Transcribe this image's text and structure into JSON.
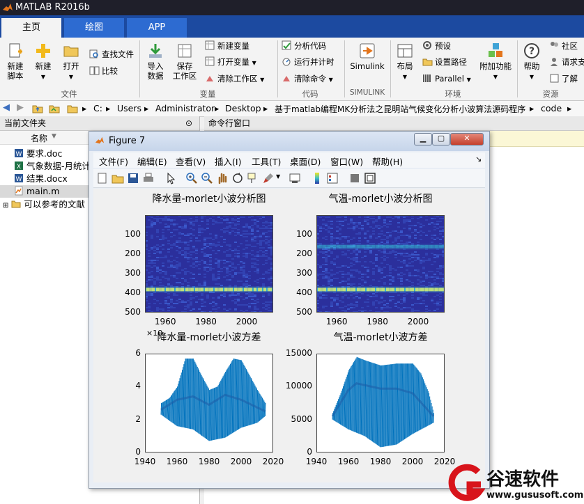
{
  "app": {
    "title": "MATLAB R2016b"
  },
  "tabs": [
    {
      "label": "主页"
    },
    {
      "label": "绘图"
    },
    {
      "label": "APP"
    }
  ],
  "ribbon": {
    "file": {
      "new_script": "新建\n脚本",
      "new": "新建",
      "open": "打开",
      "find_files": "查找文件",
      "compare": "比较",
      "group": "文件"
    },
    "variable": {
      "import": "导入\n数据",
      "save_ws": "保存\n工作区",
      "new_var": "新建变量",
      "open_var": "打开变量",
      "clear_ws": "清除工作区",
      "group": "变量"
    },
    "code": {
      "analyze": "分析代码",
      "run_time": "运行并计时",
      "clear_cmd": "清除命令",
      "group": "代码"
    },
    "simulink": {
      "simulink": "Simulink",
      "group": "SIMULINK"
    },
    "env": {
      "layout": "布局",
      "prefs": "预设",
      "set_path": "设置路径",
      "parallel": "Parallel",
      "addons": "附加功能",
      "group": "环境"
    },
    "resources": {
      "help": "帮助",
      "community": "社区",
      "request": "请求支",
      "learn": "了解",
      "group": "资源"
    }
  },
  "address": {
    "crumbs": [
      "C:",
      "Users",
      "Administrator",
      "Desktop",
      "基于matlab编程MK分析法之昆明站气候变化分析小波算法源码程序",
      "code"
    ]
  },
  "left_panel": {
    "title": "当前文件夹",
    "col_name": "名称",
    "files": [
      {
        "name": "要求.doc"
      },
      {
        "name": "气象数据-月统计"
      },
      {
        "name": "结果.docx"
      },
      {
        "name": "main.m"
      },
      {
        "name": "可以参考的文献"
      }
    ]
  },
  "right_panel": {
    "title": "命令行窗口"
  },
  "figure": {
    "title": "Figure 7",
    "menu": [
      "文件(F)",
      "编辑(E)",
      "查看(V)",
      "插入(I)",
      "工具(T)",
      "桌面(D)",
      "窗口(W)",
      "帮助(H)"
    ],
    "colors": {
      "heat_bg": "#2b2f9c",
      "heat_band": "#37c7d8",
      "series": "#0072bd"
    }
  },
  "chart_data": [
    {
      "type": "heatmap",
      "title": "降水量-morlet小波分析图",
      "x_ticks": [
        "1960",
        "1980",
        "2000"
      ],
      "y_ticks": [
        "100",
        "200",
        "300",
        "400",
        "500"
      ],
      "xlim": [
        1950,
        2013
      ],
      "ylim": [
        0,
        500
      ],
      "y_reversed": true,
      "bands": [
        {
          "y": 380,
          "strength": 0.9
        }
      ]
    },
    {
      "type": "heatmap",
      "title": "气温-morlet小波分析图",
      "x_ticks": [
        "1960",
        "1980",
        "2000"
      ],
      "y_ticks": [
        "100",
        "200",
        "300",
        "400",
        "500"
      ],
      "xlim": [
        1950,
        2013
      ],
      "ylim": [
        0,
        500
      ],
      "y_reversed": true,
      "bands": [
        {
          "y": 160,
          "strength": 0.35
        },
        {
          "y": 380,
          "strength": 0.95
        }
      ]
    },
    {
      "type": "line",
      "title": "降水量-morlet小波方差",
      "exponent_label": "×10",
      "x_ticks": [
        "1940",
        "1960",
        "1980",
        "2000",
        "2020"
      ],
      "y_ticks": [
        "0",
        "2",
        "4",
        "6"
      ],
      "xlim": [
        1940,
        2020
      ],
      "ylim": [
        0,
        6
      ],
      "envelope": [
        [
          1950,
          3.0
        ],
        [
          1955,
          3.3
        ],
        [
          1960,
          4.0
        ],
        [
          1965,
          5.7
        ],
        [
          1970,
          5.7
        ],
        [
          1975,
          4.7
        ],
        [
          1980,
          3.8
        ],
        [
          1985,
          4.0
        ],
        [
          1990,
          4.9
        ],
        [
          1995,
          5.7
        ],
        [
          2000,
          5.6
        ],
        [
          2005,
          4.7
        ],
        [
          2010,
          3.8
        ],
        [
          2015,
          3.0
        ]
      ],
      "center": [
        [
          1950,
          2.6
        ],
        [
          1960,
          3.2
        ],
        [
          1970,
          3.4
        ],
        [
          1980,
          2.9
        ],
        [
          1990,
          3.5
        ],
        [
          2000,
          3.2
        ],
        [
          2015,
          2.5
        ]
      ],
      "lower": [
        [
          1950,
          2.3
        ],
        [
          1960,
          1.6
        ],
        [
          1970,
          1.4
        ],
        [
          1980,
          0.7
        ],
        [
          1990,
          0.9
        ],
        [
          2000,
          1.5
        ],
        [
          2010,
          1.8
        ],
        [
          2015,
          2.2
        ]
      ]
    },
    {
      "type": "line",
      "title": "气温-morlet小波方差",
      "x_ticks": [
        "1940",
        "1960",
        "1980",
        "2000",
        "2020"
      ],
      "y_ticks": [
        "0",
        "5000",
        "10000",
        "15000"
      ],
      "xlim": [
        1940,
        2020
      ],
      "ylim": [
        0,
        15000
      ],
      "envelope": [
        [
          1950,
          6000
        ],
        [
          1955,
          9000
        ],
        [
          1960,
          12500
        ],
        [
          1965,
          14500
        ],
        [
          1970,
          14000
        ],
        [
          1980,
          13200
        ],
        [
          1990,
          13500
        ],
        [
          2000,
          13500
        ],
        [
          2005,
          12000
        ],
        [
          2010,
          9000
        ],
        [
          2013,
          6000
        ]
      ],
      "center": [
        [
          1950,
          5500
        ],
        [
          1960,
          9500
        ],
        [
          1965,
          10500
        ],
        [
          1980,
          9700
        ],
        [
          1990,
          9700
        ],
        [
          2000,
          9000
        ],
        [
          2013,
          5500
        ]
      ],
      "lower": [
        [
          1950,
          5000
        ],
        [
          1960,
          3500
        ],
        [
          1970,
          2500
        ],
        [
          1980,
          800
        ],
        [
          1990,
          1200
        ],
        [
          2000,
          2800
        ],
        [
          2013,
          4500
        ]
      ]
    }
  ],
  "watermark": {
    "brand": "谷速软件",
    "url": "www.gususoft.com"
  }
}
